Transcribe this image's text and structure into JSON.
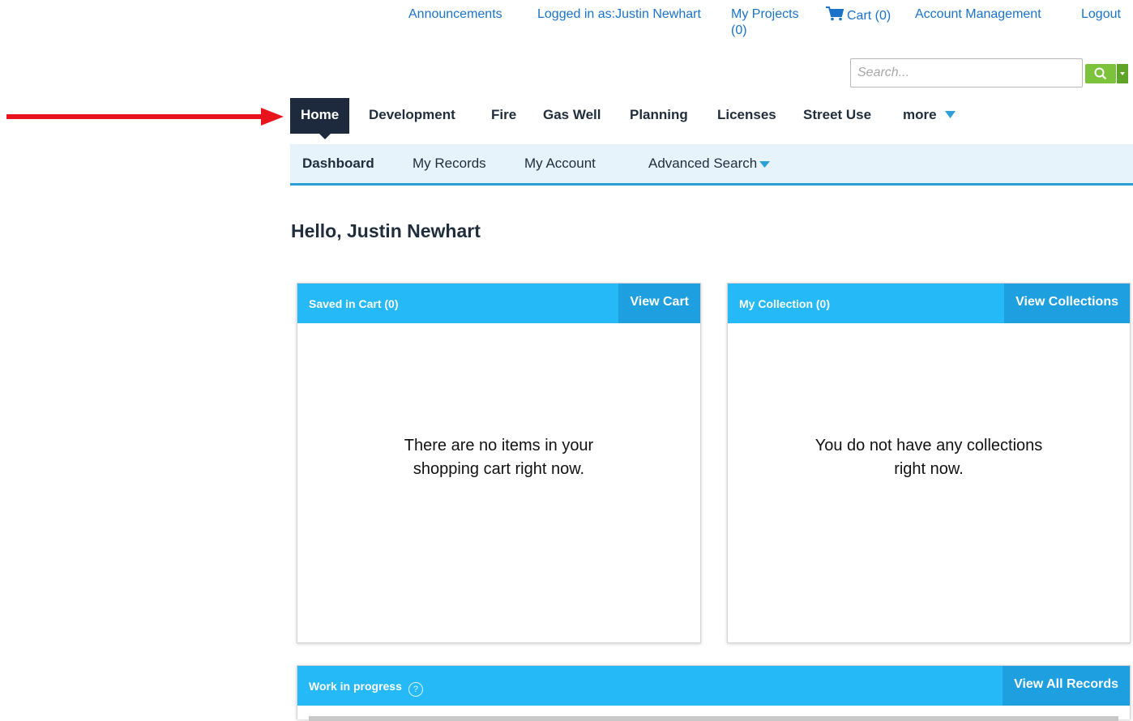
{
  "top_links": {
    "announcements": "Announcements",
    "logged_in_as": "Logged in as:Justin Newhart",
    "my_projects_line1": "My Projects",
    "my_projects_line2": "(0)",
    "cart": "Cart (0)",
    "account_management": "Account Management",
    "logout": "Logout"
  },
  "search": {
    "placeholder": "Search..."
  },
  "main_nav": {
    "items": [
      {
        "label": "Home"
      },
      {
        "label": "Development"
      },
      {
        "label": "Fire"
      },
      {
        "label": "Gas Well"
      },
      {
        "label": "Planning"
      },
      {
        "label": "Licenses"
      },
      {
        "label": "Street Use"
      },
      {
        "label": "more"
      }
    ]
  },
  "sub_nav": {
    "items": [
      {
        "label": "Dashboard"
      },
      {
        "label": "My Records"
      },
      {
        "label": "My Account"
      },
      {
        "label": "Advanced Search"
      }
    ]
  },
  "greeting": "Hello, Justin Newhart",
  "cards": {
    "cart": {
      "title": "Saved in Cart (0)",
      "action": "View Cart",
      "empty_line1": "There are no items in your",
      "empty_line2": "shopping cart right now."
    },
    "collection": {
      "title": "My Collection (0)",
      "action": "View Collections",
      "empty_line1": "You do not have any collections",
      "empty_line2": "right now."
    },
    "work": {
      "title": "Work in progress",
      "help": "?",
      "action": "View All Records"
    }
  },
  "colors": {
    "link": "#1a73c8",
    "nav_active": "#1d2a3d",
    "card_header": "#25b9f7",
    "card_action": "#1d9fe0",
    "search_button": "#7cc23a",
    "arrow": "#e8141b"
  }
}
